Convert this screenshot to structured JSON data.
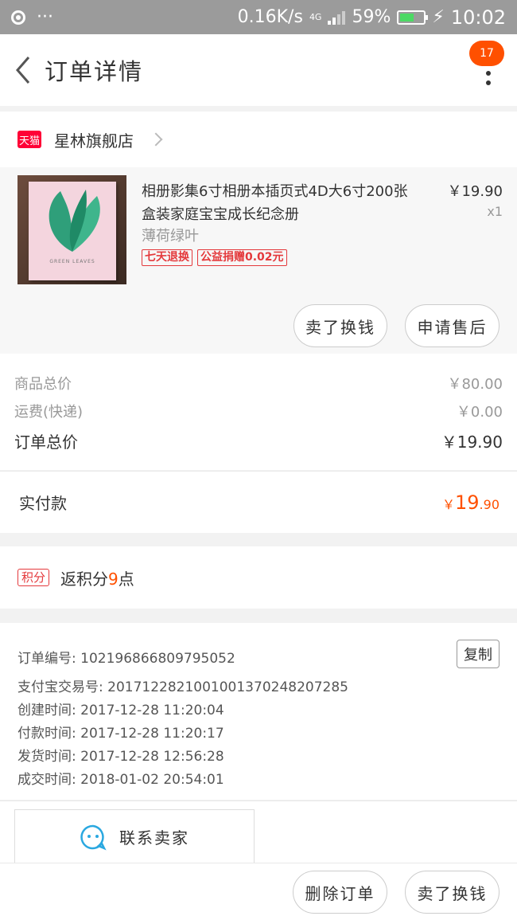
{
  "status_bar": {
    "network_speed": "0.16K/s",
    "network_type": "4G",
    "battery": "59%",
    "battery_fraction": 0.59,
    "time": "10:02"
  },
  "header": {
    "title": "订单详情",
    "notification_count": "17"
  },
  "shop": {
    "platform_badge": "天猫",
    "name": "星林旗舰店"
  },
  "product": {
    "title": "相册影集6寸相册本插页式4D大6寸200张盒装家庭宝宝成长纪念册",
    "spec": "薄荷绿叶",
    "tags": [
      "七天退换",
      "公益捐赠0.02元"
    ],
    "price": "￥19.90",
    "quantity": "x1",
    "cover_caption": "GREEN LEAVES",
    "actions": {
      "sell": "卖了换钱",
      "after_sale": "申请售后"
    }
  },
  "pricing": {
    "goods_total_label": "商品总价",
    "goods_total": "￥80.00",
    "shipping_label": "运费(快递)",
    "shipping": "￥0.00",
    "order_total_label": "订单总价",
    "order_total": "￥19.90",
    "paid_label": "实付款",
    "paid_currency": "￥",
    "paid_int": "19",
    "paid_dec": ".90"
  },
  "points": {
    "badge": "积分",
    "prefix": "返积分",
    "value": "9",
    "suffix": "点"
  },
  "order_info": {
    "lines": [
      "订单编号: 102196866809795052",
      "支付宝交易号: 2017122821001001370248207285",
      "创建时间: 2017-12-28 11:20:04",
      "付款时间: 2017-12-28 11:20:17",
      "发货时间: 2017-12-28 12:56:28",
      "成交时间: 2018-01-02 20:54:01"
    ],
    "copy_label": "复制"
  },
  "contact": {
    "label": "联系卖家"
  },
  "bottom_actions": {
    "delete": "删除订单",
    "sell": "卖了换钱"
  },
  "colors": {
    "accent": "#ff5000",
    "tag_red": "#e4393c",
    "tmall_red": "#ff0036",
    "chat_blue": "#2aa8e0"
  }
}
